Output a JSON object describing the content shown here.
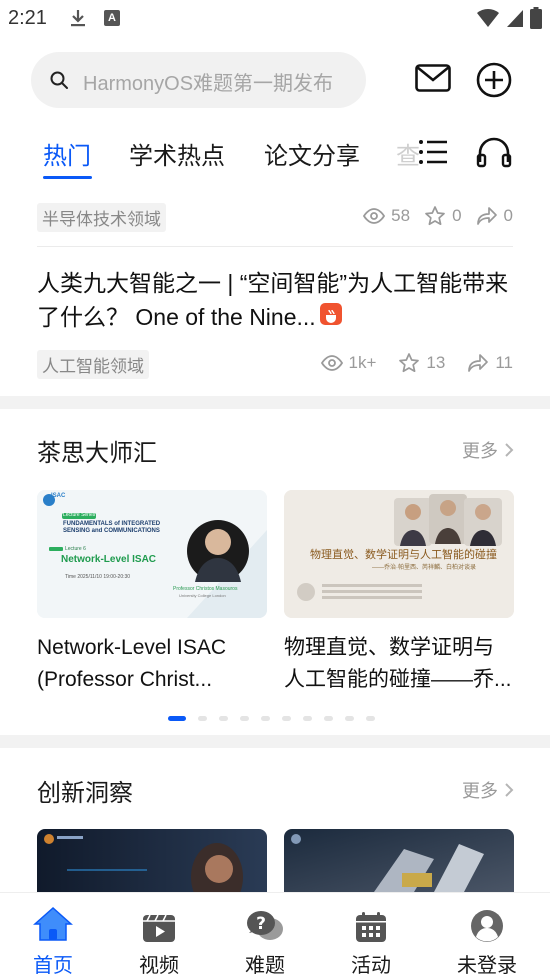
{
  "status_bar": {
    "time": "2:21",
    "a_badge": "A"
  },
  "search": {
    "placeholder": "HarmonyOS难题第一期发布"
  },
  "tabs": [
    {
      "label": "热门"
    },
    {
      "label": "学术热点"
    },
    {
      "label": "论文分享"
    },
    {
      "label": "查"
    }
  ],
  "feed": [
    {
      "tag": "半导体技术领域",
      "views": "58",
      "stars": "0",
      "shares": "0"
    },
    {
      "title": "人类九大智能之一 | “空间智能”为人工智能带来了什么？ One of the Nine...",
      "tag": "人工智能领域",
      "views": "1k+",
      "stars": "13",
      "shares": "11"
    }
  ],
  "section_masters": {
    "title": "茶思大师汇",
    "more": "更多",
    "cards": [
      {
        "title": "Network-Level ISAC (Professor Christ...",
        "poster": {
          "series_tag": "Lecture Series",
          "heading": "FUNDAMENTALS of INTEGRATED SENSING and COMMUNICATIONS",
          "lecture": "Lecture 6",
          "topic": "Network-Level ISAC",
          "time": "Time 2025/11/10 19:00-20:30",
          "speaker": "Professor Christos Masouros",
          "affiliation": "University College London"
        }
      },
      {
        "title": "物理直觉、数学证明与人工智能的碰撞——乔...",
        "poster": {
          "heading": "物理直觉、数学证明与人工智能的碰撞",
          "subheading": "——乔治·帕里西、芮祥麟、白柏对谈录"
        }
      }
    ],
    "pager_count": 10,
    "pager_active": 0
  },
  "section_insight": {
    "title": "创新洞察",
    "more": "更多"
  },
  "bottom_nav": [
    {
      "label": "首页",
      "icon": "home-icon",
      "active": true
    },
    {
      "label": "视频",
      "icon": "video-icon",
      "active": false
    },
    {
      "label": "难题",
      "icon": "question-icon",
      "active": false
    },
    {
      "label": "活动",
      "icon": "calendar-icon",
      "active": false
    },
    {
      "label": "未登录",
      "icon": "avatar-icon",
      "active": false
    }
  ],
  "colors": {
    "accent": "#0a59f7",
    "hot_badge": "#f0532f"
  }
}
